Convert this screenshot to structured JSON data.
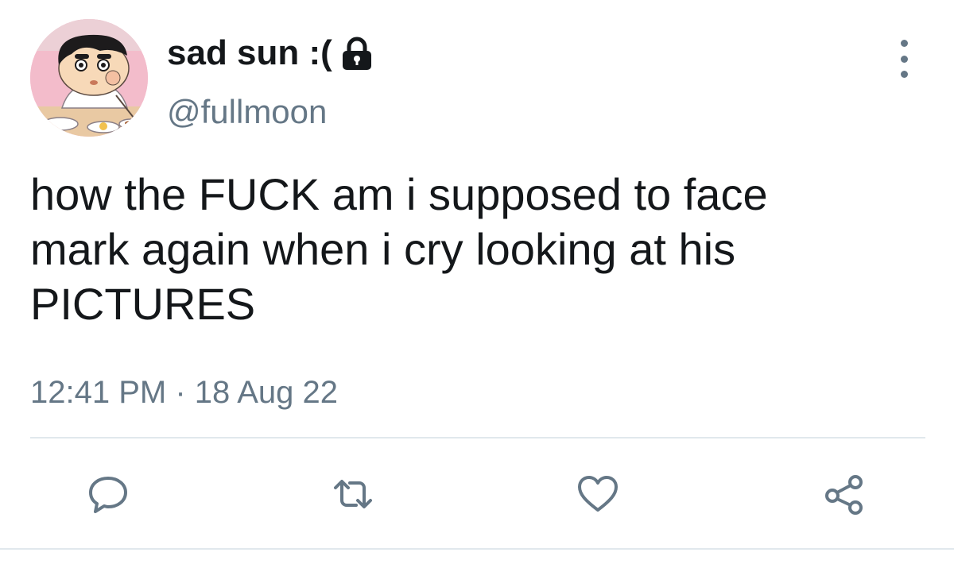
{
  "user": {
    "display_name": "sad sun :(",
    "handle": "@fullmoon",
    "avatar_icon": "cartoon-boy-avatar",
    "locked_icon": "lock-icon"
  },
  "tweet": {
    "text_lines": [
      "how the FUCK am i supposed to face",
      "mark again when i cry looking at his",
      "PICTURES"
    ],
    "time": "12:41 PM",
    "separator": "·",
    "date": "18 Aug 22"
  },
  "actions": {
    "reply_icon": "comment-icon",
    "retweet_icon": "retweet-icon",
    "like_icon": "heart-icon",
    "share_icon": "share-icon"
  },
  "colors": {
    "text": "#14171a",
    "secondary": "#657786",
    "divider": "#e1e8ed"
  }
}
